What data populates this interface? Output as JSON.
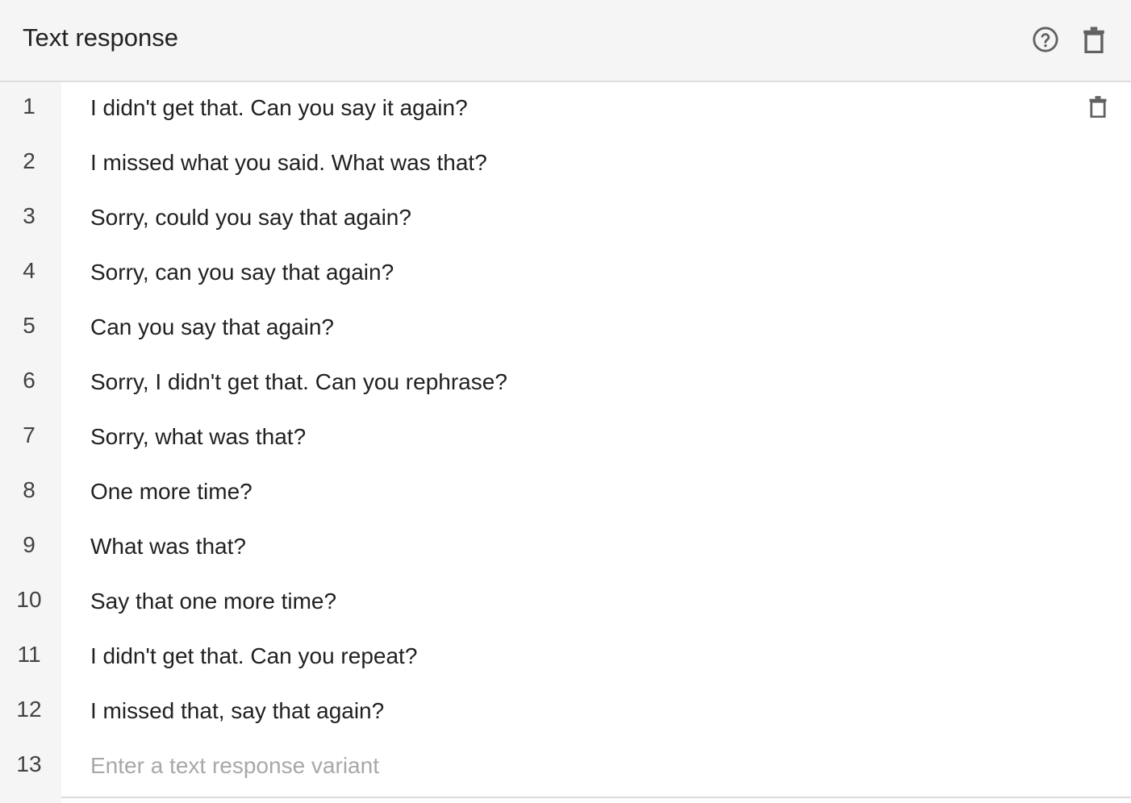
{
  "header": {
    "title": "Text response",
    "help_icon": "help-circle-icon",
    "delete_icon": "trash-icon"
  },
  "responses": [
    {
      "index": "1",
      "text": "I didn't get that. Can you say it again?"
    },
    {
      "index": "2",
      "text": "I missed what you said. What was that?"
    },
    {
      "index": "3",
      "text": "Sorry, could you say that again?"
    },
    {
      "index": "4",
      "text": "Sorry, can you say that again?"
    },
    {
      "index": "5",
      "text": "Can you say that again?"
    },
    {
      "index": "6",
      "text": "Sorry, I didn't get that. Can you rephrase?"
    },
    {
      "index": "7",
      "text": "Sorry, what was that?"
    },
    {
      "index": "8",
      "text": "One more time?"
    },
    {
      "index": "9",
      "text": "What was that?"
    },
    {
      "index": "10",
      "text": "Say that one more time?"
    },
    {
      "index": "11",
      "text": "I didn't get that. Can you repeat?"
    },
    {
      "index": "12",
      "text": "I missed that, say that again?"
    }
  ],
  "new_row": {
    "index": "13",
    "placeholder": "Enter a text response variant"
  },
  "colors": {
    "header_bg": "#f5f5f5",
    "gutter_bg": "#f5f5f5",
    "text": "#212121",
    "icon": "#616161",
    "placeholder": "#a8a8a8"
  }
}
